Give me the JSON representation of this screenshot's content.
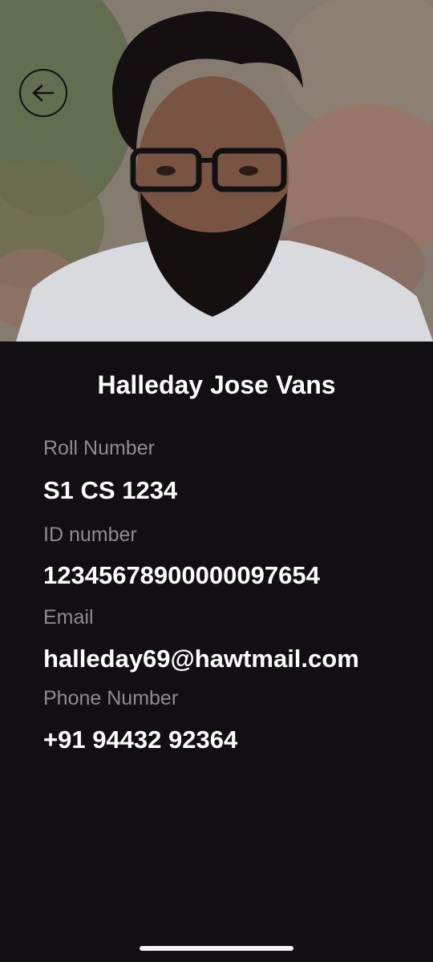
{
  "profile": {
    "name": "Halleday Jose Vans",
    "fields": [
      {
        "label": "Roll Number",
        "value": "S1 CS 1234"
      },
      {
        "label": "ID number",
        "value": "12345678900000097654"
      },
      {
        "label": "Email",
        "value": "halleday69@hawtmail.com"
      },
      {
        "label": "Phone Number",
        "value": "+91 94432 92364"
      }
    ]
  },
  "icons": {
    "back": "arrow-left-icon"
  },
  "colors": {
    "background": "#110f11",
    "label": "#8f8c8f",
    "value": "#ffffff"
  }
}
